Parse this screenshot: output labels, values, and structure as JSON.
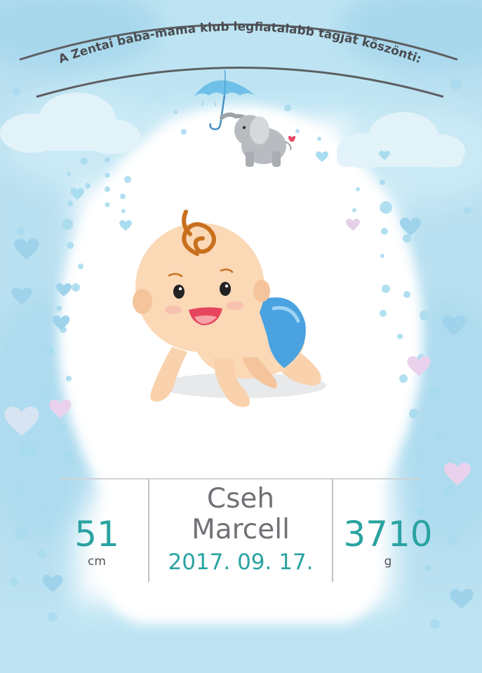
{
  "card": {
    "header": "A Zentai baba-mama klub legfiatalabb tagját köszönti:",
    "baby": {
      "first_line": "Cseh",
      "second_line": "Marcell",
      "birth_date": "2017. 09. 17."
    },
    "length": {
      "value": "51",
      "unit": "cm"
    },
    "weight": {
      "value": "3710",
      "unit": "g"
    }
  },
  "colors": {
    "accent_teal": "#2aa3a1",
    "name_gray": "#6f7276",
    "watercolor_blue": "#a9dcef",
    "diaper_blue": "#4aa3e0",
    "skin": "#f9d2ad",
    "hair": "#c8701e"
  },
  "icons": [
    "umbrella-icon",
    "elephant-icon",
    "heart-icon",
    "baby-illustration",
    "cloud-icon"
  ]
}
